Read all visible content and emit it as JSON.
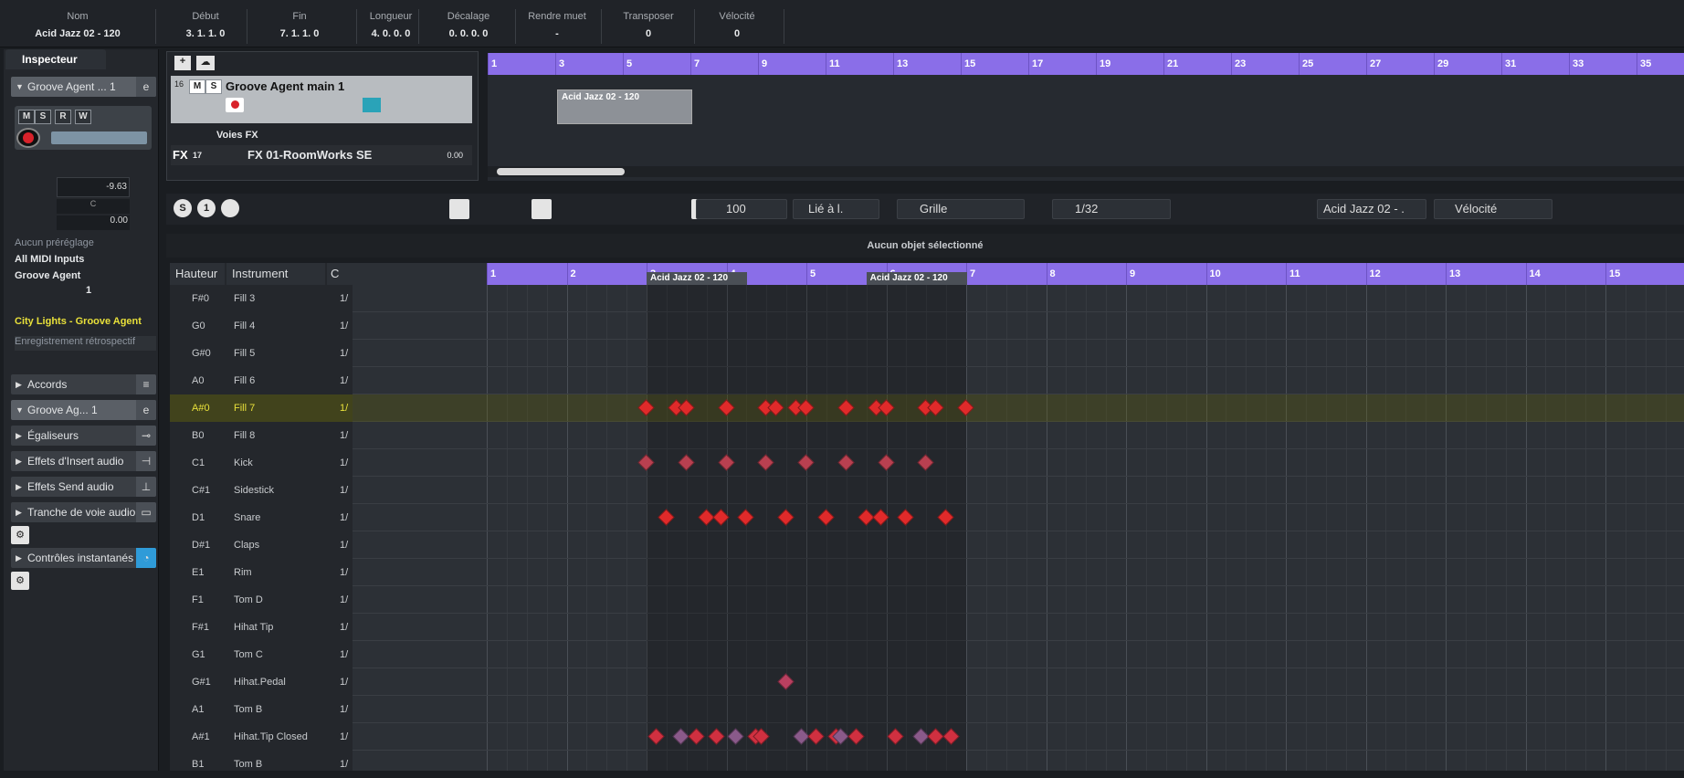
{
  "info": {
    "cols": [
      {
        "label": "Nom",
        "value": "Acid Jazz 02  - 120"
      },
      {
        "label": "Début",
        "value": "3. 1. 1.   0"
      },
      {
        "label": "Fin",
        "value": "7. 1. 1.   0"
      },
      {
        "label": "Longueur",
        "value": "4. 0. 0.   0"
      },
      {
        "label": "Décalage",
        "value": "0. 0. 0.   0"
      },
      {
        "label": "Rendre muet",
        "value": "-"
      },
      {
        "label": "Transposer",
        "value": "0"
      },
      {
        "label": "Vélocité",
        "value": "0"
      }
    ]
  },
  "inspector": {
    "tab": "Inspecteur",
    "track_name": "Groove Agent ... 1",
    "volume": "-9.63",
    "pan": "C",
    "pan_value": "0.00",
    "preset": "Aucun préréglage",
    "midi_in": "All MIDI Inputs",
    "instrument": "Groove Agent",
    "channel": "1",
    "program": "City Lights - Groove Agent",
    "retro": "Enregistrement rétrospectif",
    "sections": [
      "Accords",
      "Groove Ag... 1",
      "Égaliseurs",
      "Effets d'Insert audio",
      "Effets Send audio",
      "Tranche de voie audio",
      "Contrôles instantanés"
    ]
  },
  "tracklist": {
    "track1_num": "16",
    "track1_name": "Groove Agent main 1",
    "folder_name": "Voies FX",
    "fx_num": "17",
    "fx_name": "FX 01-RoomWorks SE",
    "fx_val": "0.00"
  },
  "arrange": {
    "bars": [
      "1",
      "3",
      "5",
      "7",
      "9",
      "11",
      "13",
      "15",
      "17",
      "19",
      "21",
      "23",
      "25",
      "27",
      "29",
      "31",
      "33",
      "35"
    ],
    "part_label": "Acid Jazz 02  - 120"
  },
  "toolbar": {
    "velocity_value": "100",
    "quant_mode": "Lié à l.",
    "grid_label": "Grille",
    "quant_value": "1/32",
    "part_select": "Acid Jazz 02  - .",
    "lane_select": "Vélocité"
  },
  "status": "Aucun objet sélectionné",
  "editor": {
    "col_pitch": "Hauteur",
    "col_instr": "Instrument",
    "col_c": "C",
    "bars": [
      "1",
      "2",
      "3",
      "4",
      "5",
      "6",
      "7",
      "8",
      "9",
      "10",
      "11",
      "12",
      "13",
      "14",
      "15"
    ],
    "part_label": "Acid Jazz 02  - 120",
    "rows": [
      {
        "pitch": "F#0",
        "instr": "Fill 3",
        "q": "1/"
      },
      {
        "pitch": "G0",
        "instr": "Fill 4",
        "q": "1/"
      },
      {
        "pitch": "G#0",
        "instr": "Fill 5",
        "q": "1/"
      },
      {
        "pitch": "A0",
        "instr": "Fill 6",
        "q": "1/"
      },
      {
        "pitch": "A#0",
        "instr": "Fill 7",
        "q": "1/"
      },
      {
        "pitch": "B0",
        "instr": "Fill 8",
        "q": "1/"
      },
      {
        "pitch": "C1",
        "instr": "Kick",
        "q": "1/"
      },
      {
        "pitch": "C#1",
        "instr": "Sidestick",
        "q": "1/"
      },
      {
        "pitch": "D1",
        "instr": "Snare",
        "q": "1/"
      },
      {
        "pitch": "D#1",
        "instr": "Claps",
        "q": "1/"
      },
      {
        "pitch": "E1",
        "instr": "Rim",
        "q": "1/"
      },
      {
        "pitch": "F1",
        "instr": "Tom D",
        "q": "1/"
      },
      {
        "pitch": "F#1",
        "instr": "Hihat Tip",
        "q": "1/"
      },
      {
        "pitch": "G1",
        "instr": "Tom C",
        "q": "1/"
      },
      {
        "pitch": "G#1",
        "instr": "Hihat.Pedal",
        "q": "1/"
      },
      {
        "pitch": "A1",
        "instr": "Tom B",
        "q": "1/"
      },
      {
        "pitch": "A#1",
        "instr": "Hihat.Tip Closed",
        "q": "1/"
      },
      {
        "pitch": "B1",
        "instr": "Tom B",
        "q": "1/"
      }
    ],
    "notes": [
      {
        "row": 4,
        "pos": [
          3.0,
          3.375,
          3.5,
          4.0,
          4.5,
          4.625,
          4.875,
          5.0,
          5.5,
          5.875,
          6.0,
          6.5,
          6.625,
          7.0
        ]
      },
      {
        "row": 6,
        "pos": [
          3.0,
          3.5,
          4.0,
          4.5,
          5.0,
          5.5,
          6.0,
          6.5
        ]
      },
      {
        "row": 8,
        "pos": [
          3.25,
          3.75,
          3.938,
          4.25,
          4.75,
          5.25,
          5.75,
          5.938,
          6.25,
          6.75
        ]
      },
      {
        "row": 14,
        "pos": [
          4.75
        ]
      },
      {
        "row": 16,
        "pos": [
          3.125,
          3.438,
          3.625,
          3.875,
          4.125,
          4.375,
          4.438,
          4.938,
          5.125,
          5.375,
          5.438,
          5.625,
          6.125,
          6.438,
          6.625,
          6.813
        ]
      }
    ]
  }
}
